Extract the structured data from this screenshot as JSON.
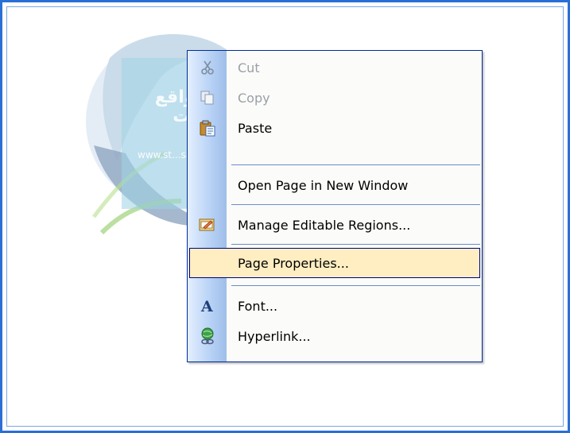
{
  "menu": {
    "items": [
      {
        "label": "Cut",
        "icon": "scissors-icon",
        "enabled": false
      },
      {
        "label": "Copy",
        "icon": "copy-icon",
        "enabled": false
      },
      {
        "label": "Paste",
        "icon": "paste-icon",
        "enabled": true
      },
      {
        "label": "Open Page in New Window",
        "icon": "",
        "enabled": true
      },
      {
        "label": "Manage Editable Regions...",
        "icon": "editable-regions-icon",
        "enabled": true
      },
      {
        "label": "Page Properties...",
        "icon": "",
        "enabled": true,
        "highlighted": true
      },
      {
        "label": "Font...",
        "icon": "font-icon",
        "enabled": true
      },
      {
        "label": "Hyperlink...",
        "icon": "hyperlink-icon",
        "enabled": true
      }
    ]
  },
  "watermark": {
    "arabic_text": "تحميل المواقع والواجهات",
    "url": "www.st...sa.com"
  },
  "colors": {
    "frame_border": "#2a6fd6",
    "menu_border": "#002d96",
    "highlight_fill": "#ffeec2",
    "disabled_text": "#9aa0a8"
  }
}
